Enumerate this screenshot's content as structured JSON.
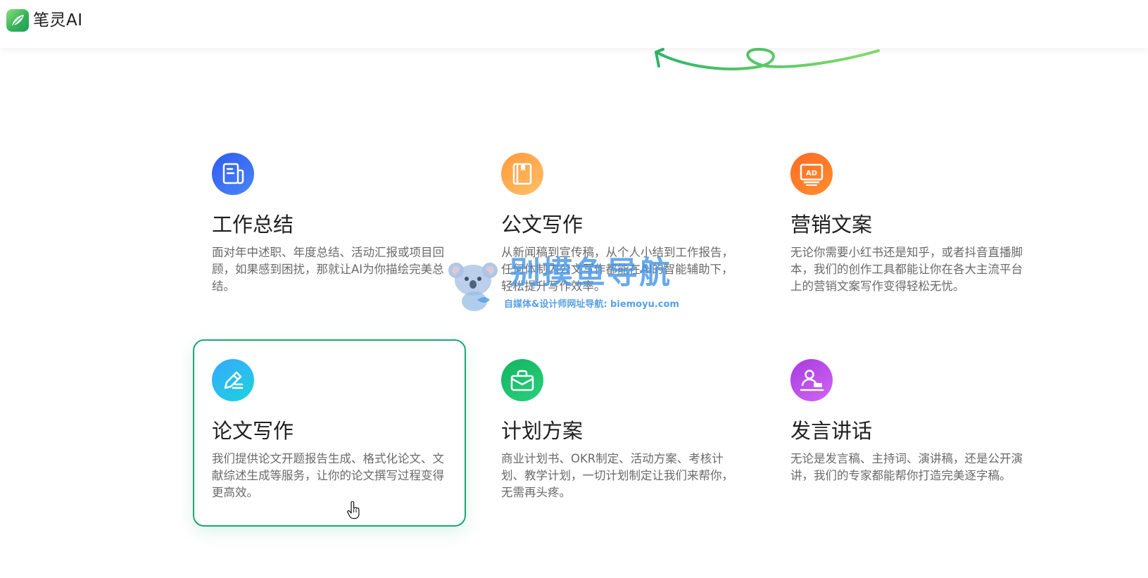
{
  "header": {
    "logo_text": "笔灵AI"
  },
  "colors": {
    "brand_green": "#1aa870",
    "icon_blue": "#2e5bf0",
    "icon_orange": "#ff9a3a",
    "icon_red": "#ff6a23",
    "icon_cyan": "#36a9ff",
    "icon_green": "#12b45e",
    "icon_purple": "#a63ce2"
  },
  "cards": [
    {
      "icon": "document-icon",
      "title": "工作总结",
      "desc": "面对年中述职、年度总结、活动汇报或项目回顾，如果感到困扰，那就让AI为你描绘完美总结。"
    },
    {
      "icon": "notebook-icon",
      "title": "公文写作",
      "desc": "从新闻稿到宣传稿，从个人小结到工作报告，任何体制内公文写作都能在AI的智能辅助下，轻松提升写作效率。"
    },
    {
      "icon": "ad-monitor-icon",
      "title": "营销文案",
      "desc": "无论你需要小红书还是知乎，或者抖音直播脚本，我们的创作工具都能让你在各大主流平台上的营销文案写作变得轻松无忧。"
    },
    {
      "icon": "pen-edit-icon",
      "title": "论文写作",
      "desc": "我们提供论文开题报告生成、格式化论文、文献综述生成等服务，让你的论文撰写过程变得更高效。"
    },
    {
      "icon": "briefcase-icon",
      "title": "计划方案",
      "desc": "商业计划书、OKR制定、活动方案、考核计划、教学计划，一切计划制定让我们来帮你，无需再头疼。"
    },
    {
      "icon": "speaker-podium-icon",
      "title": "发言讲话",
      "desc": "无论是发言稿、主持词、演讲稿，还是公开演讲，我们的专家都能帮你打造完美逐字稿。"
    }
  ],
  "watermark": {
    "title": "别摸鱼导航",
    "subtitle": "自媒体&设计师网址导航: biemoyu.com"
  }
}
